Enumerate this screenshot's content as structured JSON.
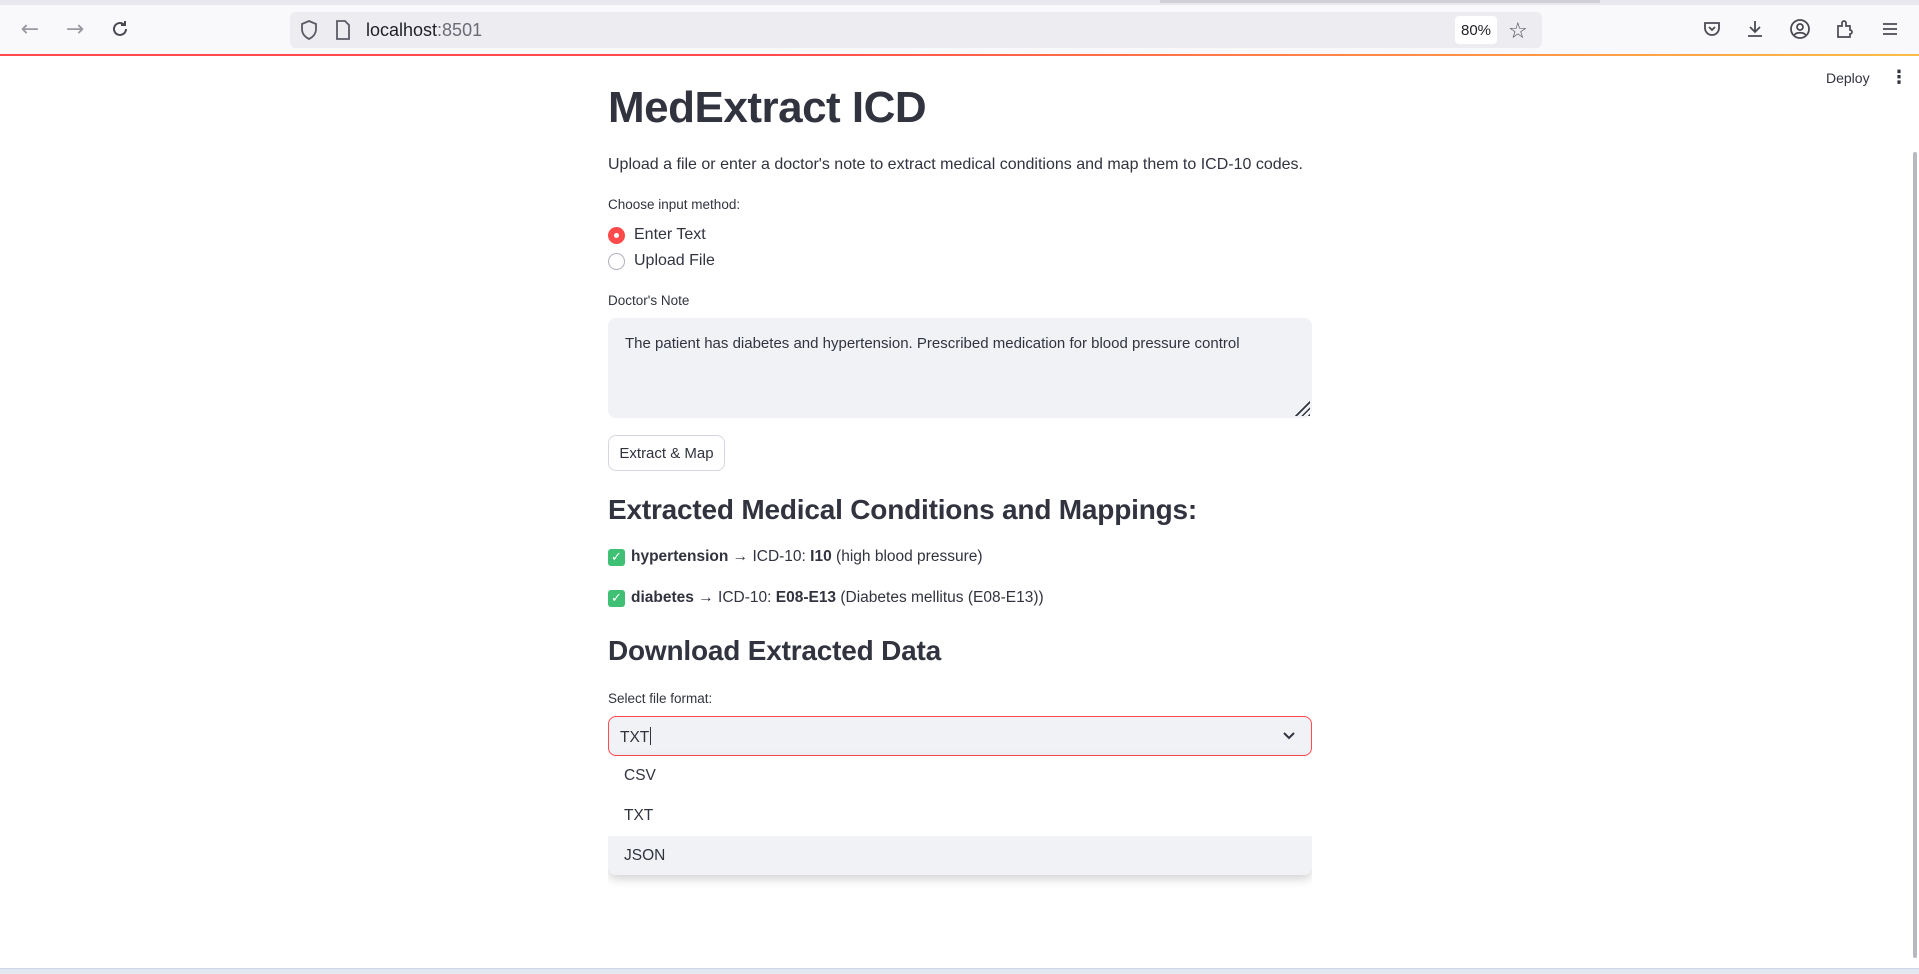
{
  "browser": {
    "url_host": "localhost",
    "url_port": ":8501",
    "zoom": "80%"
  },
  "header": {
    "deploy_label": "Deploy"
  },
  "app": {
    "title": "MedExtract ICD",
    "description": "Upload a file or enter a doctor's note to extract medical conditions and map them to ICD-10 codes.",
    "input_method": {
      "label": "Choose input method:",
      "options": [
        "Enter Text",
        "Upload File"
      ],
      "selected": "Enter Text"
    },
    "note": {
      "label": "Doctor's Note",
      "value": "The patient has diabetes and hypertension. Prescribed medication for blood pressure control"
    },
    "extract_button": "Extract & Map",
    "results_heading": "Extracted Medical Conditions and Mappings:",
    "conditions": [
      {
        "term": "hypertension",
        "arrow": "→",
        "prefix": "ICD-10:",
        "code": "I10",
        "desc": "(high blood pressure)"
      },
      {
        "term": "diabetes",
        "arrow": "→",
        "prefix": "ICD-10:",
        "code": "E08-E13",
        "desc": "(Diabetes mellitus (E08-E13))"
      }
    ],
    "download_heading": "Download Extracted Data",
    "format": {
      "label": "Select file format:",
      "value": "TXT",
      "options": [
        "CSV",
        "TXT",
        "JSON"
      ],
      "highlighted": "JSON"
    }
  },
  "colors": {
    "accent": "#ff4b4b",
    "check": "#40c074",
    "input_bg": "#f0f2f6",
    "text": "#31333f"
  }
}
